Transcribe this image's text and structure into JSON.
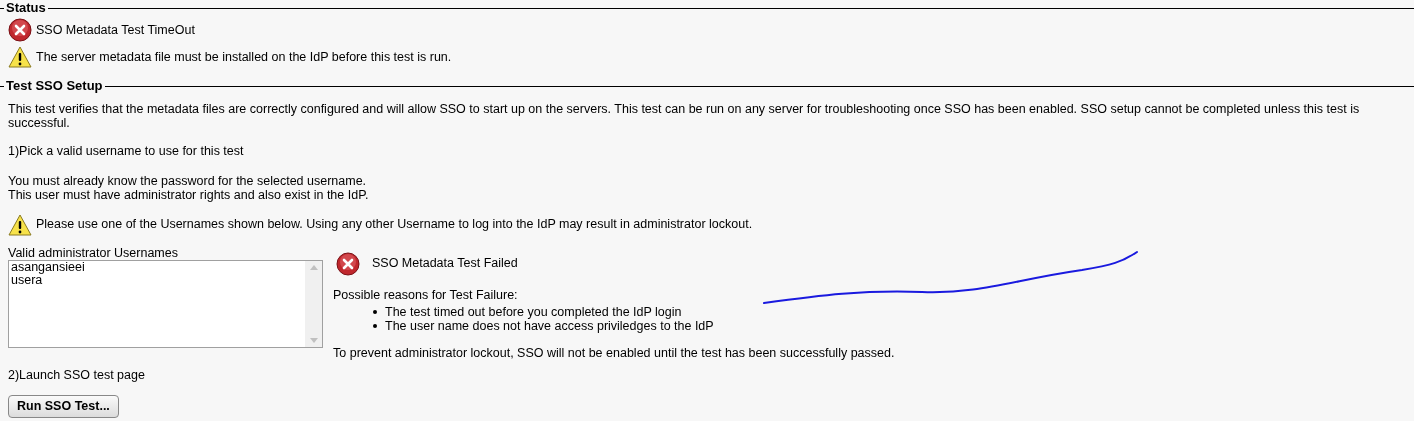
{
  "status": {
    "legend": "Status",
    "messages": [
      {
        "kind": "error",
        "text": "SSO Metadata Test TimeOut"
      },
      {
        "kind": "warning",
        "text": "The server metadata file must be installed on the IdP before this test is run."
      }
    ]
  },
  "setup": {
    "legend": "Test SSO Setup",
    "description": "This test verifies that the metadata files are correctly configured and will allow SSO to start up on the servers. This test can be run on any server for troubleshooting once SSO has been enabled. SSO setup cannot be completed unless this test is successful.",
    "step1": "1)Pick a valid username to use for this test",
    "notes": [
      "You must already know the password for the selected username.",
      "This user must have administrator rights and also exist in the IdP."
    ],
    "warning": "Please use one of the Usernames shown below. Using any other Username to log into the IdP may result in administrator lockout.",
    "list_label": "Valid administrator Usernames",
    "usernames": [
      {
        "name": "asangansieei",
        "selected": false
      },
      {
        "name": "usera",
        "selected": false
      }
    ],
    "result": {
      "kind": "error",
      "title": "SSO Metadata Test Failed",
      "reasons_heading": "Possible reasons for Test Failure:",
      "reasons": [
        "The test timed out before you completed the IdP login",
        "The user name does not have access priviledges to the IdP"
      ],
      "footer": "To prevent administrator lockout, SSO will not be enabled until the test has been successfully passed."
    },
    "step2": "2)Launch SSO test page",
    "button": "Run SSO Test..."
  }
}
